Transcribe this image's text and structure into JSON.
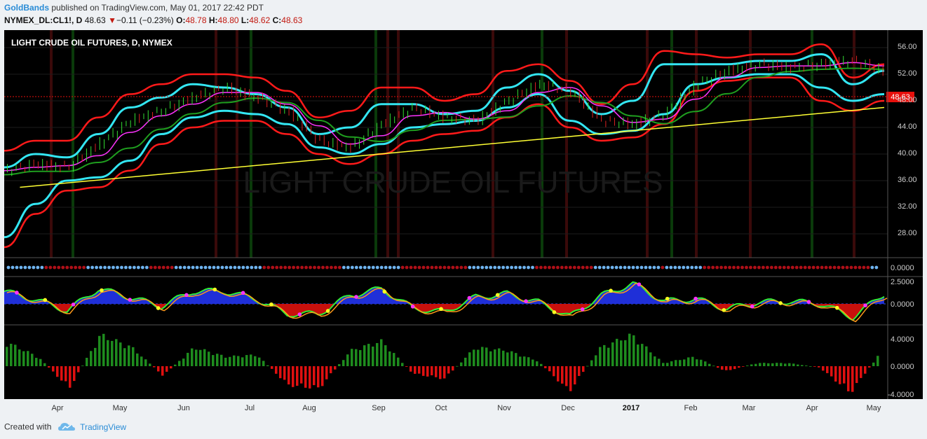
{
  "header": {
    "author": "GoldBands",
    "published": "published on TradingView.com, May 01, 2017 22:42 PDT",
    "symbol": "NYMEX_DL:CL1!, D",
    "last": "48.63",
    "change_arrow": "▼",
    "change": "−0.11 (−0.23%)",
    "open_label": "O:",
    "open": "48.78",
    "high_label": "H:",
    "high": "48.80",
    "low_label": "L:",
    "low": "48.62",
    "close_label": "C:",
    "close": "48.63"
  },
  "footer": {
    "created_with": "Created with",
    "brand": "TradingView",
    "logo_icon": "tradingview-cloud-icon"
  },
  "colors": {
    "background": "#000000",
    "upper_band": "#ff1a1a",
    "mid_band": "#33e6f2",
    "trend": "#ffff33",
    "sma": "#1f9e1f",
    "ema": "#ff33ff",
    "up_hist": "#1e8c1e",
    "down_hist": "#e01010",
    "price_tag": "#e8100c"
  },
  "chart_data": [
    {
      "type": "line",
      "title": "LIGHT CRUDE OIL FUTURES, D, NYMEX",
      "watermark": "LIGHT CRUDE OIL FUTURES",
      "y_ticks": [
        "56.00",
        "52.00",
        "48.00",
        "44.00",
        "40.00",
        "36.00",
        "32.00",
        "28.00"
      ],
      "ylim": [
        25.0,
        58.5
      ],
      "price_label": "48.63",
      "x_labels": [
        "Apr",
        "May",
        "Jun",
        "Jul",
        "Aug",
        "Sep",
        "Oct",
        "Nov",
        "Dec",
        "2017",
        "Feb",
        "Mar",
        "Apr",
        "May"
      ],
      "x": [
        0,
        10,
        20,
        30,
        40,
        50,
        60,
        70,
        80,
        90,
        100,
        110,
        120,
        130,
        140,
        150,
        160,
        170,
        180,
        190,
        200,
        210,
        220,
        230,
        240,
        250,
        260,
        270,
        280
      ],
      "series": [
        {
          "key": "price",
          "values": [
            37.5,
            38.5,
            38.0,
            41.5,
            45.0,
            46.5,
            48.5,
            50.0,
            48.5,
            46.5,
            42.0,
            41.0,
            44.5,
            47.0,
            45.5,
            45.0,
            48.0,
            50.5,
            49.5,
            45.0,
            44.5,
            46.0,
            50.5,
            52.5,
            53.5,
            53.0,
            53.5,
            54.0,
            52.5
          ]
        },
        {
          "key": "upper",
          "values": [
            40.5,
            42.0,
            42.0,
            45.5,
            49.0,
            50.5,
            52.0,
            52.0,
            51.5,
            49.5,
            45.5,
            46.5,
            50.0,
            50.0,
            48.0,
            49.0,
            52.5,
            53.5,
            51.0,
            47.5,
            50.5,
            55.5,
            55.0,
            54.5,
            55.0,
            55.0,
            56.5,
            51.5,
            53.5
          ]
        },
        {
          "key": "upper_cyan",
          "values": [
            38.0,
            40.0,
            39.5,
            43.0,
            47.0,
            48.5,
            50.5,
            50.0,
            49.0,
            47.0,
            43.0,
            44.0,
            47.5,
            47.5,
            46.0,
            46.5,
            50.0,
            52.0,
            49.5,
            46.0,
            48.0,
            53.5,
            53.5,
            53.5,
            54.0,
            54.0,
            55.0,
            50.5,
            52.5
          ]
        },
        {
          "key": "lower_cyan",
          "values": [
            27.5,
            32.5,
            36.0,
            36.5,
            39.0,
            43.0,
            45.5,
            46.5,
            46.0,
            44.5,
            41.0,
            40.0,
            41.5,
            44.0,
            44.5,
            45.0,
            47.0,
            49.0,
            45.0,
            43.0,
            43.5,
            46.0,
            50.5,
            51.5,
            52.0,
            52.0,
            50.0,
            48.0,
            49.0
          ]
        },
        {
          "key": "lower",
          "values": [
            26.0,
            31.0,
            34.5,
            35.0,
            37.5,
            41.5,
            44.0,
            45.0,
            45.0,
            43.0,
            40.0,
            38.5,
            40.0,
            42.0,
            43.0,
            43.5,
            45.5,
            47.5,
            44.0,
            42.0,
            42.5,
            44.5,
            49.5,
            51.0,
            51.5,
            51.5,
            48.0,
            46.5,
            48.0
          ]
        }
      ],
      "trendline": {
        "x": [
          5,
          280
        ],
        "y": [
          35.0,
          47.0
        ]
      }
    },
    {
      "type": "scatter",
      "title": "",
      "y_ticks": [
        "0.0000"
      ]
    },
    {
      "type": "area",
      "title": "",
      "y_ticks": [
        "2.5000",
        "0.0000"
      ],
      "x": [
        0,
        10,
        20,
        30,
        40,
        50,
        60,
        70,
        80,
        90,
        100,
        110,
        120,
        130,
        140,
        150,
        160,
        170,
        180,
        190,
        200,
        210,
        220,
        230,
        240,
        250,
        260,
        270,
        280
      ],
      "values": [
        1.5,
        0.5,
        -0.8,
        1.8,
        0.8,
        -0.3,
        1.5,
        1.5,
        0.6,
        -1.2,
        -1.2,
        1.0,
        1.8,
        -0.5,
        -1.0,
        0.8,
        1.2,
        0.2,
        -1.5,
        1.0,
        2.4,
        0.3,
        0.6,
        -0.6,
        0.2,
        0.3,
        0.0,
        -1.6,
        1.2
      ]
    },
    {
      "type": "bar",
      "title": "",
      "y_ticks": [
        "4.0000",
        "0.0000",
        "-4.0000"
      ],
      "x": [
        0,
        10,
        20,
        30,
        40,
        50,
        60,
        70,
        80,
        90,
        100,
        110,
        120,
        130,
        140,
        150,
        160,
        170,
        180,
        190,
        200,
        210,
        220,
        230,
        240,
        250,
        260,
        270,
        280
      ],
      "values": [
        3.8,
        1.5,
        -3.5,
        5.0,
        3.0,
        -1.5,
        3.0,
        1.5,
        1.8,
        -3.0,
        -3.5,
        2.5,
        4.0,
        -1.2,
        -2.0,
        3.0,
        2.5,
        0.8,
        -4.0,
        3.0,
        5.0,
        0.5,
        1.5,
        -0.8,
        0.5,
        0.5,
        -0.2,
        -4.2,
        2.5
      ]
    }
  ]
}
